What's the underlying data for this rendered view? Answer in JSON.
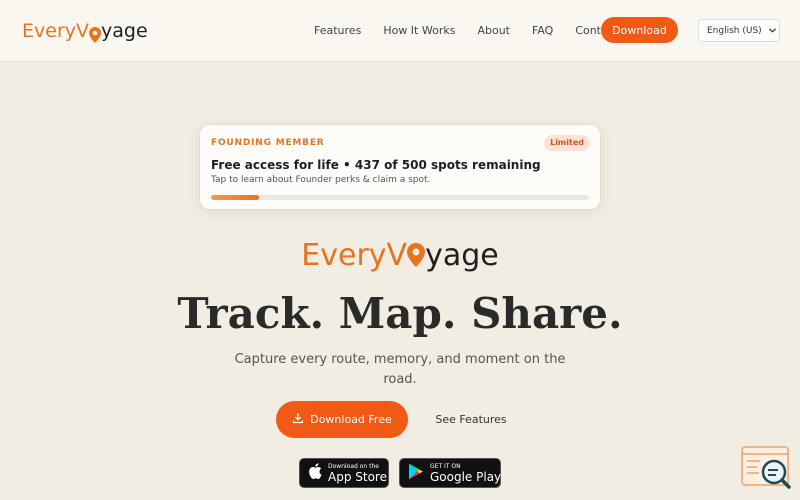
{
  "brand": {
    "part1": "Every",
    "part2": "V",
    "part3": "yage"
  },
  "nav": {
    "links": [
      "Features",
      "How It Works",
      "About",
      "FAQ",
      "Contact"
    ],
    "download_label": "Download",
    "language": "English (US)"
  },
  "founding_card": {
    "eyebrow": "FOUNDING MEMBER",
    "badge": "Limited",
    "title": "Free access for life • 437 of 500 spots remaining",
    "subtitle": "Tap to learn about Founder perks & claim a spot.",
    "progress_fraction": 0.127
  },
  "hero": {
    "headline": "Track. Map. Share.",
    "tagline": "Capture every route, memory, and moment on the road.",
    "primary_cta": "Download Free",
    "secondary_cta": "See Features"
  },
  "stores": {
    "apple": {
      "small": "Download on the",
      "big": "App Store"
    },
    "google": {
      "small": "GET IT ON",
      "big": "Google Play"
    }
  },
  "icons": {
    "pin": "map-pin-icon",
    "download": "download-icon",
    "apple": "apple-icon",
    "play": "play-triangle-icon",
    "chevron": "chevron-down-icon",
    "widget": "search-browser-icon"
  },
  "colors": {
    "accent": "#f15a15",
    "brand_orange": "#e8731f",
    "background": "#f1ede3"
  }
}
